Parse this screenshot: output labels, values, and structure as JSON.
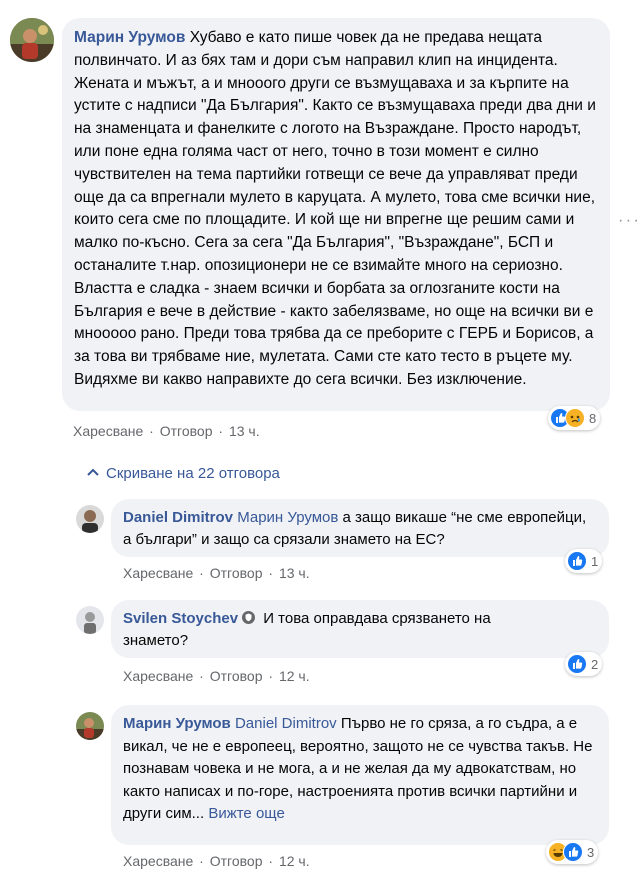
{
  "comments": [
    {
      "author": "Марин Урумов",
      "text": "Хубаво е като пише човек да не предава нещата полвинчато. И аз бях там и дори съм направил клип на инцидента. Жената и мъжът, а и мнооого други се възмущаваха и за кърпите на устите с надписи \"Да България\". Както се възмущаваха преди два дни и на знаменцата и фанелките с логото на Възраждане. Просто народът, или поне една голяма част от него, точно в този момент е силно чувствителен на тема партийки готвещи се вече да управляват преди още да са впрегнали мулето в каруцата. А мулето, това сме всички ние, които сега сме по площадите. И кой ще ни впрегне ще решим сами и малко по-късно. Сега за сега \"Да България\", \"Възраждане\", БСП и останалите т.нар. опозиционери не се взимайте много на сериозно. Властта е сладка - знаем всички и борбата за оглозганите кости на България е вече в действие - както забелязваме, но още на всички ви е мнооооо рано. Преди това трябва да се преборите с ГЕРБ и Борисов, а за това ви трябваме ние, мулетата. Сами сте като тесто в ръцете му. Видяхме ви какво направихте до сега всички. Без изключение.",
      "like": "Харесване",
      "reply": "Отговор",
      "time": "13 ч.",
      "reaction_count": "8",
      "reaction_icons": [
        "like-icon",
        "sad-icon"
      ]
    }
  ],
  "hide_replies": "Скриване на 22 отговора",
  "replies": [
    {
      "author": "Daniel Dimitrov",
      "mention": "Марин Урумов",
      "text": " а защо викаше “не сме европейци, а българи” и защо са срязали знамето на ЕС?",
      "like": "Харесване",
      "reply": "Отговор",
      "time": "13 ч.",
      "reaction_count": "1",
      "reaction_icons": [
        "like-icon"
      ]
    },
    {
      "author": "Svilen Stoychev",
      "badge_icon": "shield-badge-icon",
      "text": " И това оправдава срязването на знамето?",
      "like": "Харесване",
      "reply": "Отговор",
      "time": "12 ч.",
      "reaction_count": "2",
      "reaction_icons": [
        "like-icon"
      ]
    },
    {
      "author": "Марин Урумов",
      "mention": "Daniel Dimitrov",
      "text": " Първо не го сряза, а го съдра, а е викал, че не е европеец, вероятно, защото не се чувства такъв. Не познавам човека и не мога, а и не желая да му адвокатствам, но както написах и по-горе, настроенията против всички партийни и други сим...",
      "see_more": "Вижте още",
      "like": "Харесване",
      "reply": "Отговор",
      "time": "12 ч.",
      "reaction_count": "3",
      "reaction_icons": [
        "haha-icon",
        "like-icon"
      ]
    }
  ],
  "colors": {
    "link": "#385898",
    "bubble": "#f0f2f5",
    "meta": "#65676b",
    "like_blue": "#1877f2",
    "emoji_yellow": "#f7b125"
  }
}
